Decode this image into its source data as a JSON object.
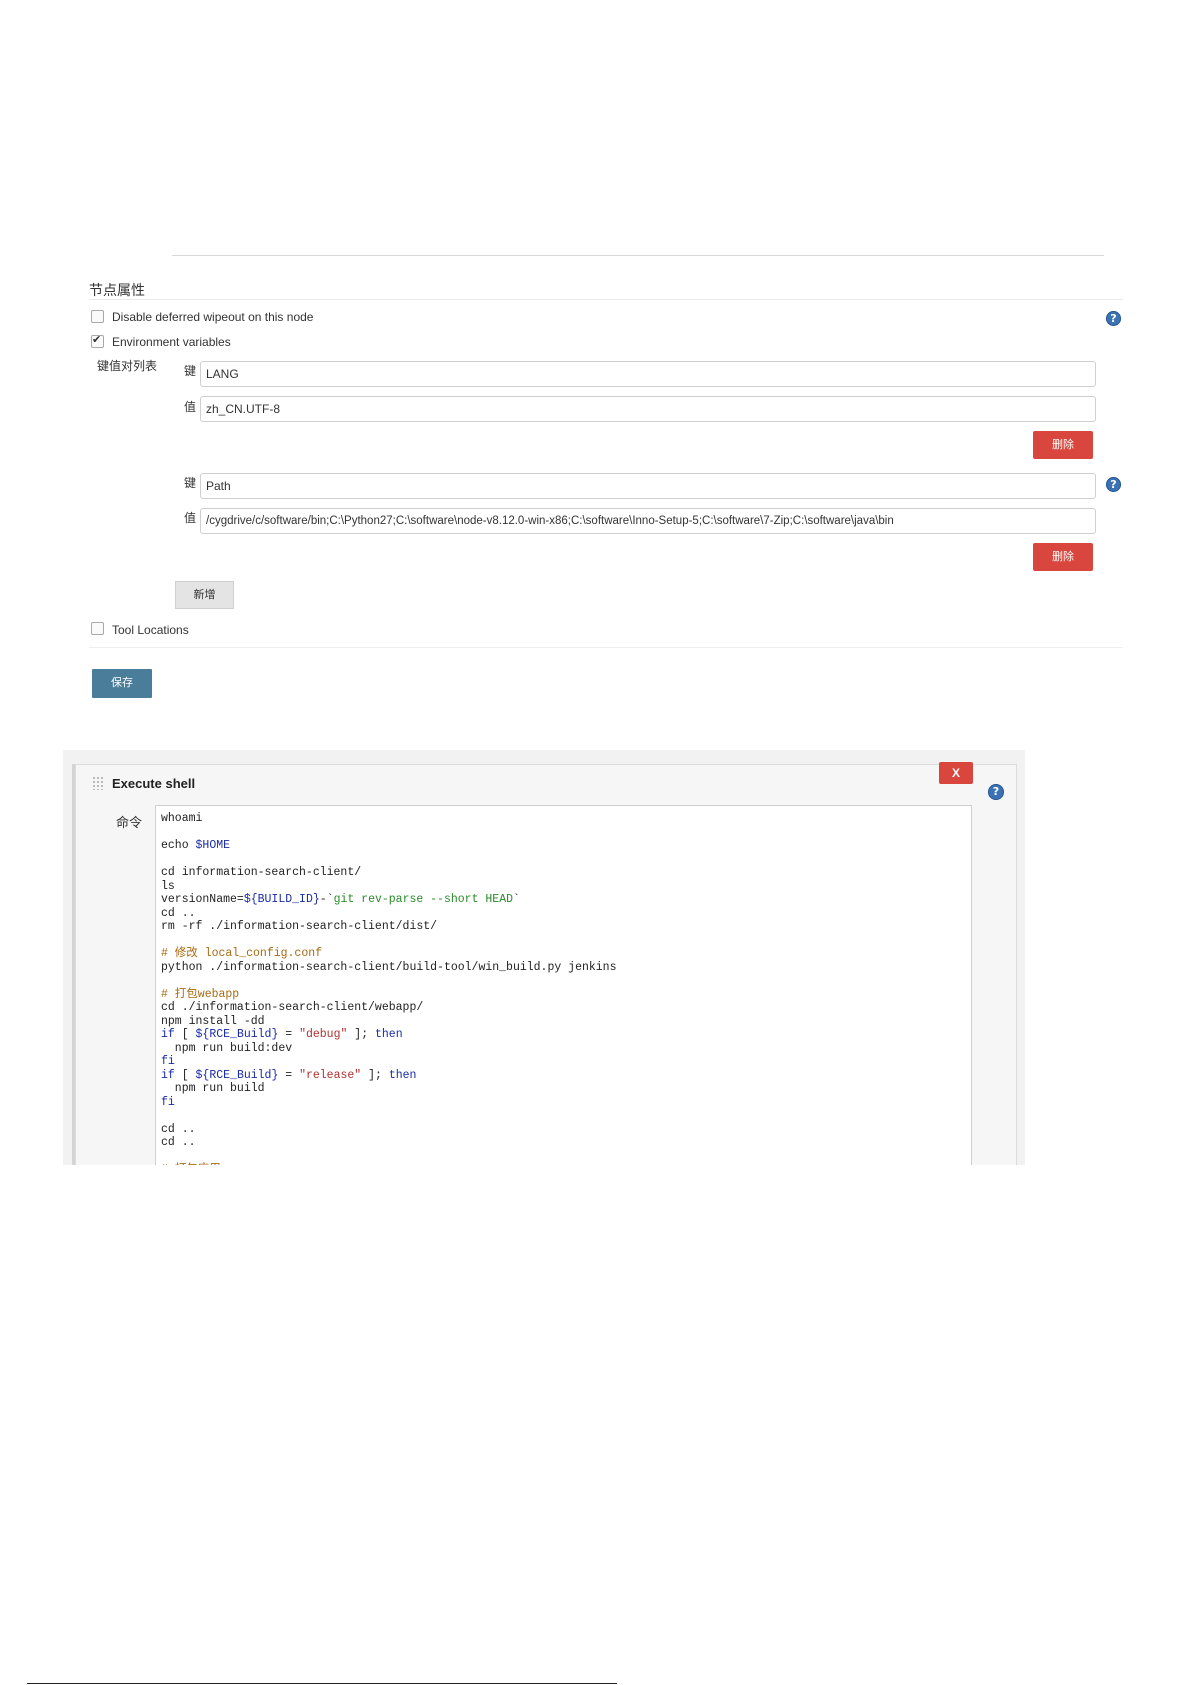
{
  "node_properties": {
    "title": "节点属性",
    "disable_wipeout_label": "Disable deferred wipeout on this node",
    "disable_wipeout_checked": false,
    "env_vars_label": "Environment variables",
    "env_vars_checked": true,
    "kv_list_label": "键值对列表",
    "key_label": "键",
    "value_label": "值",
    "entries": [
      {
        "key": "LANG",
        "value": "zh_CN.UTF-8",
        "delete_label": "删除"
      },
      {
        "key": "Path",
        "value": "/cygdrive/c/software/bin;C:\\Python27;C:\\software\\node-v8.12.0-win-x86;C:\\software\\Inno-Setup-5;C:\\software\\7-Zip;C:\\software\\java\\bin",
        "delete_label": "删除"
      }
    ],
    "add_label": "新增",
    "tool_locations_label": "Tool Locations",
    "tool_locations_checked": false,
    "save_label": "保存",
    "help_glyph": "?"
  },
  "execute_shell": {
    "title": "Execute shell",
    "close_label": "X",
    "command_label": "命令",
    "help_glyph": "?"
  },
  "icons": {
    "help": "question-circle-icon",
    "grip": "drag-handle-icon",
    "checkbox": "checkbox-icon"
  },
  "colors": {
    "danger": "#d9463d",
    "primary": "#4a7d9a",
    "help": "#3b72b4"
  }
}
